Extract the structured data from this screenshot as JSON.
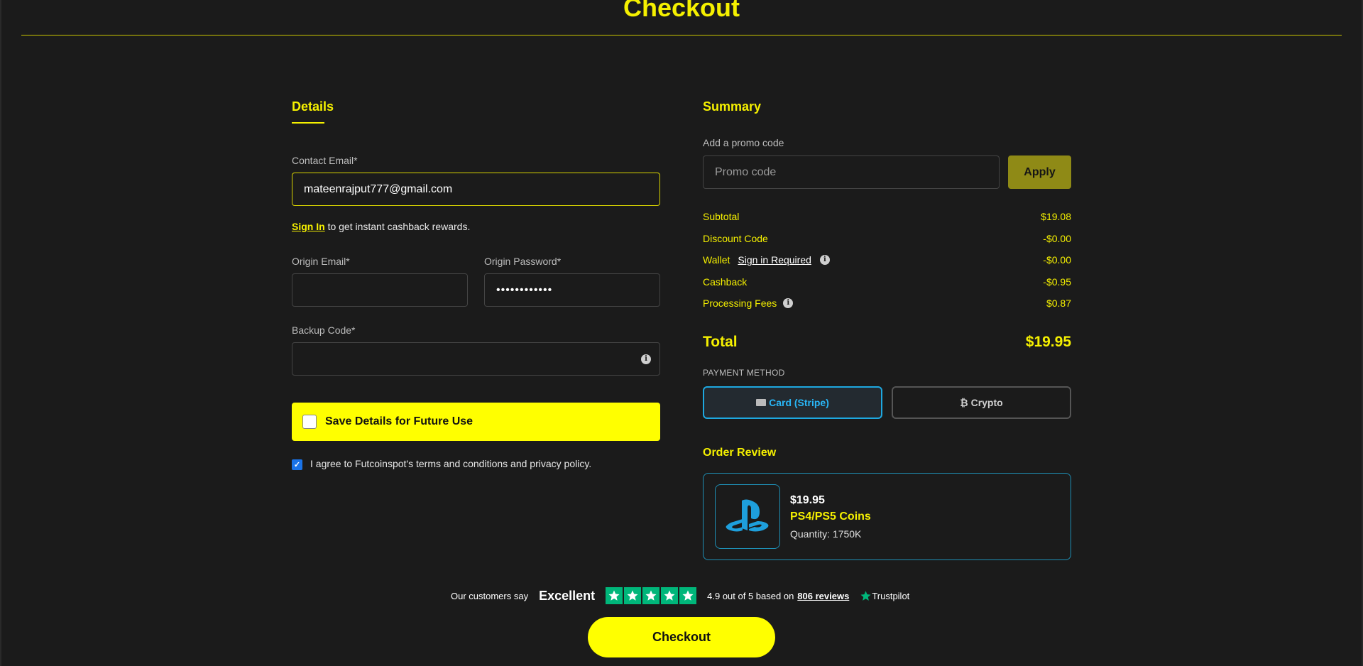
{
  "page": {
    "title": "Checkout"
  },
  "details": {
    "title": "Details",
    "contact_email_label": "Contact Email*",
    "contact_email_value": "mateenrajput777@gmail.com",
    "signin_link": "Sign In",
    "signin_text": "to get instant cashback rewards.",
    "origin_email_label": "Origin Email*",
    "origin_email_value": "",
    "origin_password_label": "Origin Password*",
    "origin_password_value": "••••••••••••",
    "backup_code_label": "Backup Code*",
    "backup_code_value": "",
    "save_label": "Save Details for Future Use",
    "save_checked": false,
    "agree_label": "I agree to Futcoinspot's terms and conditions and privacy policy.",
    "agree_checked": true
  },
  "summary": {
    "title": "Summary",
    "promo_label": "Add a promo code",
    "promo_placeholder": "Promo code",
    "apply_label": "Apply",
    "rows": {
      "subtotal": {
        "label": "Subtotal",
        "value": "$19.08"
      },
      "discount": {
        "label": "Discount Code",
        "value": "-$0.00"
      },
      "wallet": {
        "label": "Wallet",
        "link": "Sign in Required",
        "value": "-$0.00"
      },
      "cashback": {
        "label": "Cashback",
        "value": "-$0.95"
      },
      "fees": {
        "label": "Processing Fees",
        "value": "$0.87"
      }
    },
    "total_label": "Total",
    "total_value": "$19.95",
    "payment_method_label": "PAYMENT METHOD",
    "payment_card": "Card (Stripe)",
    "payment_crypto": "₿ Crypto",
    "selected_payment": "card"
  },
  "order": {
    "title": "Order Review",
    "price": "$19.95",
    "name": "PS4/PS5 Coins",
    "quantity": "Quantity: 1750K",
    "icon": "playstation-logo"
  },
  "trustpilot": {
    "say": "Our customers say",
    "excellent": "Excellent",
    "stars": 5,
    "rating_text": "4.9 out of 5 based on",
    "reviews_link": "806 reviews",
    "brand": "Trustpilot"
  },
  "checkout_button": "Checkout",
  "colors": {
    "accent": "#f5f000",
    "background": "#1b1b1b",
    "trustpilot_green": "#00b67a",
    "selected_blue": "#1ea8e0"
  }
}
